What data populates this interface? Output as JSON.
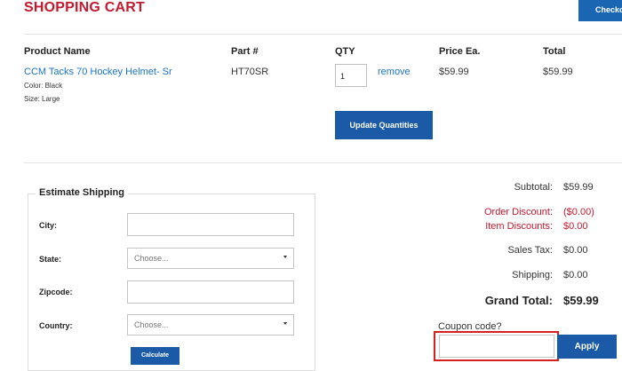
{
  "page_title": "SHOPPING CART",
  "checkout_label": "Checko",
  "columns": {
    "product": "Product Name",
    "part": "Part #",
    "qty": "QTY",
    "price": "Price Ea.",
    "total": "Total"
  },
  "item": {
    "name": "CCM Tacks 70 Hockey Helmet- Sr",
    "color": "Color: Black",
    "size": "Size: Large",
    "part": "HT70SR",
    "qty": "1",
    "remove": "remove",
    "price": "$59.99",
    "total": "$59.99"
  },
  "update_label": "Update Quantities",
  "shipping": {
    "legend": "Estimate Shipping",
    "city_label": "City:",
    "state_label": "State:",
    "state_value": "Choose...",
    "zip_label": "Zipcode:",
    "country_label": "Country:",
    "country_value": "Choose...",
    "calculate_label": "Calculate"
  },
  "summary": {
    "subtotal_label": "Subtotal:",
    "subtotal": "$59.99",
    "order_discount_label": "Order Discount:",
    "order_discount": "($0.00)",
    "item_discounts_label": "Item Discounts:",
    "item_discounts": "$0.00",
    "sales_tax_label": "Sales Tax:",
    "sales_tax": "$0.00",
    "shipping_label": "Shipping:",
    "shipping": "$0.00",
    "grand_total_label": "Grand Total:",
    "grand_total": "$59.99"
  },
  "coupon": {
    "label": "Coupon code?",
    "value": "",
    "apply_label": "Apply"
  },
  "colors": {
    "accent_red": "#c4192e",
    "button_blue": "#1a5aa6",
    "link_blue": "#1a73c2",
    "highlight": "#d81f1f"
  }
}
